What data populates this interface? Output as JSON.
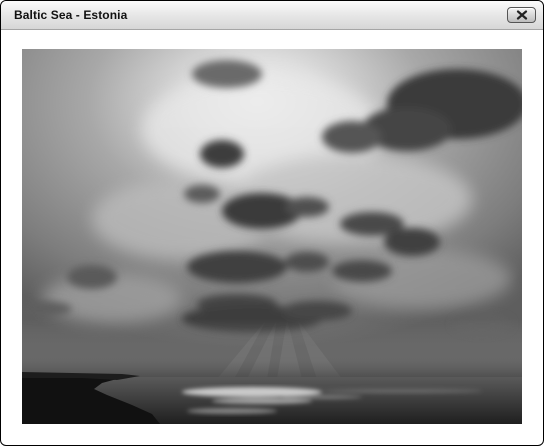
{
  "window": {
    "title": "Baltic Sea - Estonia"
  },
  "titlebar": {
    "close_icon": "close-x-icon"
  },
  "photo": {
    "subject": "black-and-white seascape photograph",
    "colors": {
      "sky_light": "#e6e6e6",
      "sky_mid": "#8f8f8f",
      "cloud_dark": "#3c3c3c",
      "sea": "#2e2e2e",
      "land": "#141414"
    }
  }
}
